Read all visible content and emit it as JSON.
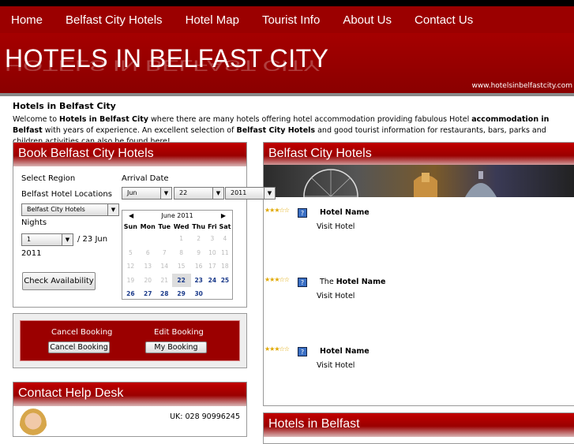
{
  "nav": {
    "items": [
      "Home",
      "Belfast City Hotels",
      "Hotel Map",
      "Tourist Info",
      "About Us",
      "Contact Us"
    ]
  },
  "banner": {
    "title": "HOTELS IN BELFAST CITY",
    "url": "www.hotelsinbelfastcity.com"
  },
  "intro": {
    "heading": "Hotels in Belfast City",
    "text_1": "Welcome to ",
    "bold_1": "Hotels in Belfast City",
    "text_2": " where there are many hotels offering hotel accommodation providing fabulous Hotel ",
    "bold_2": "accommodation in Belfast",
    "text_3": " with years of experience. An excellent selection of ",
    "bold_3": "Belfast City Hotels",
    "text_4": " and good tourist information for restaurants, bars, parks and children activities can also be found here!"
  },
  "book": {
    "title": "Book Belfast City Hotels",
    "select_region": "Select Region",
    "locations_label": "Belfast Hotel Locations",
    "location_value": "Belfast City Hotels",
    "nights_label": "Nights",
    "nights_value": "1",
    "checkout_text": "/ 23 Jun",
    "checkout_year": "2011",
    "arrival_label": "Arrival Date",
    "month_value": "Jun",
    "day_value": "22",
    "year_value": "2011",
    "check_button": "Check Availability"
  },
  "calendar": {
    "title": "June 2011",
    "prev": "◀",
    "next": "▶",
    "weekdays": [
      "Sun",
      "Mon",
      "Tue",
      "Wed",
      "Thu",
      "Fri",
      "Sat"
    ],
    "weeks": [
      [
        "",
        "",
        "",
        "1",
        "2",
        "3",
        "4"
      ],
      [
        "5",
        "6",
        "7",
        "8",
        "9",
        "10",
        "11"
      ],
      [
        "12",
        "13",
        "14",
        "15",
        "16",
        "17",
        "18"
      ],
      [
        "19",
        "20",
        "21",
        "22",
        "23",
        "24",
        "25"
      ],
      [
        "26",
        "27",
        "28",
        "29",
        "30",
        "",
        ""
      ]
    ],
    "selected_day": "22"
  },
  "booking_manage": {
    "cancel_label": "Cancel Booking",
    "cancel_button": "Cancel Booking",
    "edit_label": "Edit Booking",
    "edit_button": "My Booking"
  },
  "help": {
    "title": "Contact Help Desk",
    "phone": "UK: 028 90996245"
  },
  "hotels_panel": {
    "title": "Belfast City Hotels",
    "hotels": [
      {
        "prefix": "",
        "name": "Hotel Name",
        "link": "Visit Hotel",
        "stars": "★★★☆☆"
      },
      {
        "prefix": "The ",
        "name": "Hotel Name",
        "link": "Visit Hotel",
        "stars": "★★★☆☆"
      },
      {
        "prefix": "",
        "name": "Hotel Name",
        "link": "Visit Hotel",
        "stars": "★★★☆☆"
      }
    ],
    "help_icon": "?"
  },
  "hotels_in": {
    "title": "Hotels in Belfast"
  },
  "colors": {
    "brand_red": "#9b0000",
    "link_blue": "#1a3a8a"
  }
}
